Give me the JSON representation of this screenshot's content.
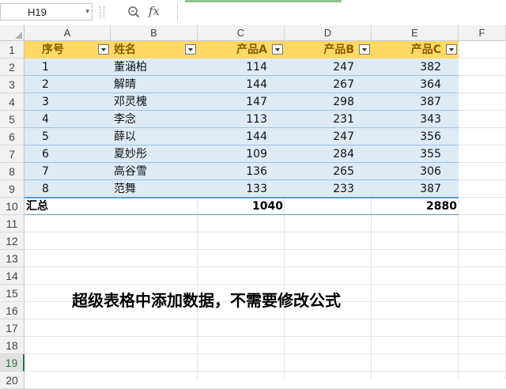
{
  "name_box": "H19",
  "formula_bar": {
    "fx_label": "fx",
    "value": ""
  },
  "columns": [
    "A",
    "B",
    "C",
    "D",
    "E",
    "F"
  ],
  "rows": [
    "1",
    "2",
    "3",
    "4",
    "5",
    "6",
    "7",
    "8",
    "9",
    "10",
    "11",
    "12",
    "13",
    "14",
    "15",
    "16",
    "17",
    "18",
    "19",
    "20"
  ],
  "active_row": "19",
  "table": {
    "headers": [
      "序号",
      "姓名",
      "产品A",
      "产品B",
      "产品C"
    ],
    "rows": [
      [
        "1",
        "董涵柏",
        "114",
        "247",
        "382"
      ],
      [
        "2",
        "解晴",
        "144",
        "267",
        "364"
      ],
      [
        "3",
        "邓灵槐",
        "147",
        "298",
        "387"
      ],
      [
        "4",
        "李念",
        "113",
        "231",
        "343"
      ],
      [
        "5",
        "薛以",
        "144",
        "247",
        "356"
      ],
      [
        "6",
        "夏妙彤",
        "109",
        "284",
        "355"
      ],
      [
        "7",
        "高谷雪",
        "136",
        "265",
        "306"
      ],
      [
        "8",
        "范舞",
        "133",
        "233",
        "387"
      ]
    ],
    "total_label": "汇总",
    "total_a": "1040",
    "total_c": "2880"
  },
  "caption": "超级表格中添加数据，不需要修改公式",
  "colors": {
    "header_fill": "#ffd966",
    "body_fill": "#ddebf7",
    "active_green": "#217346"
  }
}
